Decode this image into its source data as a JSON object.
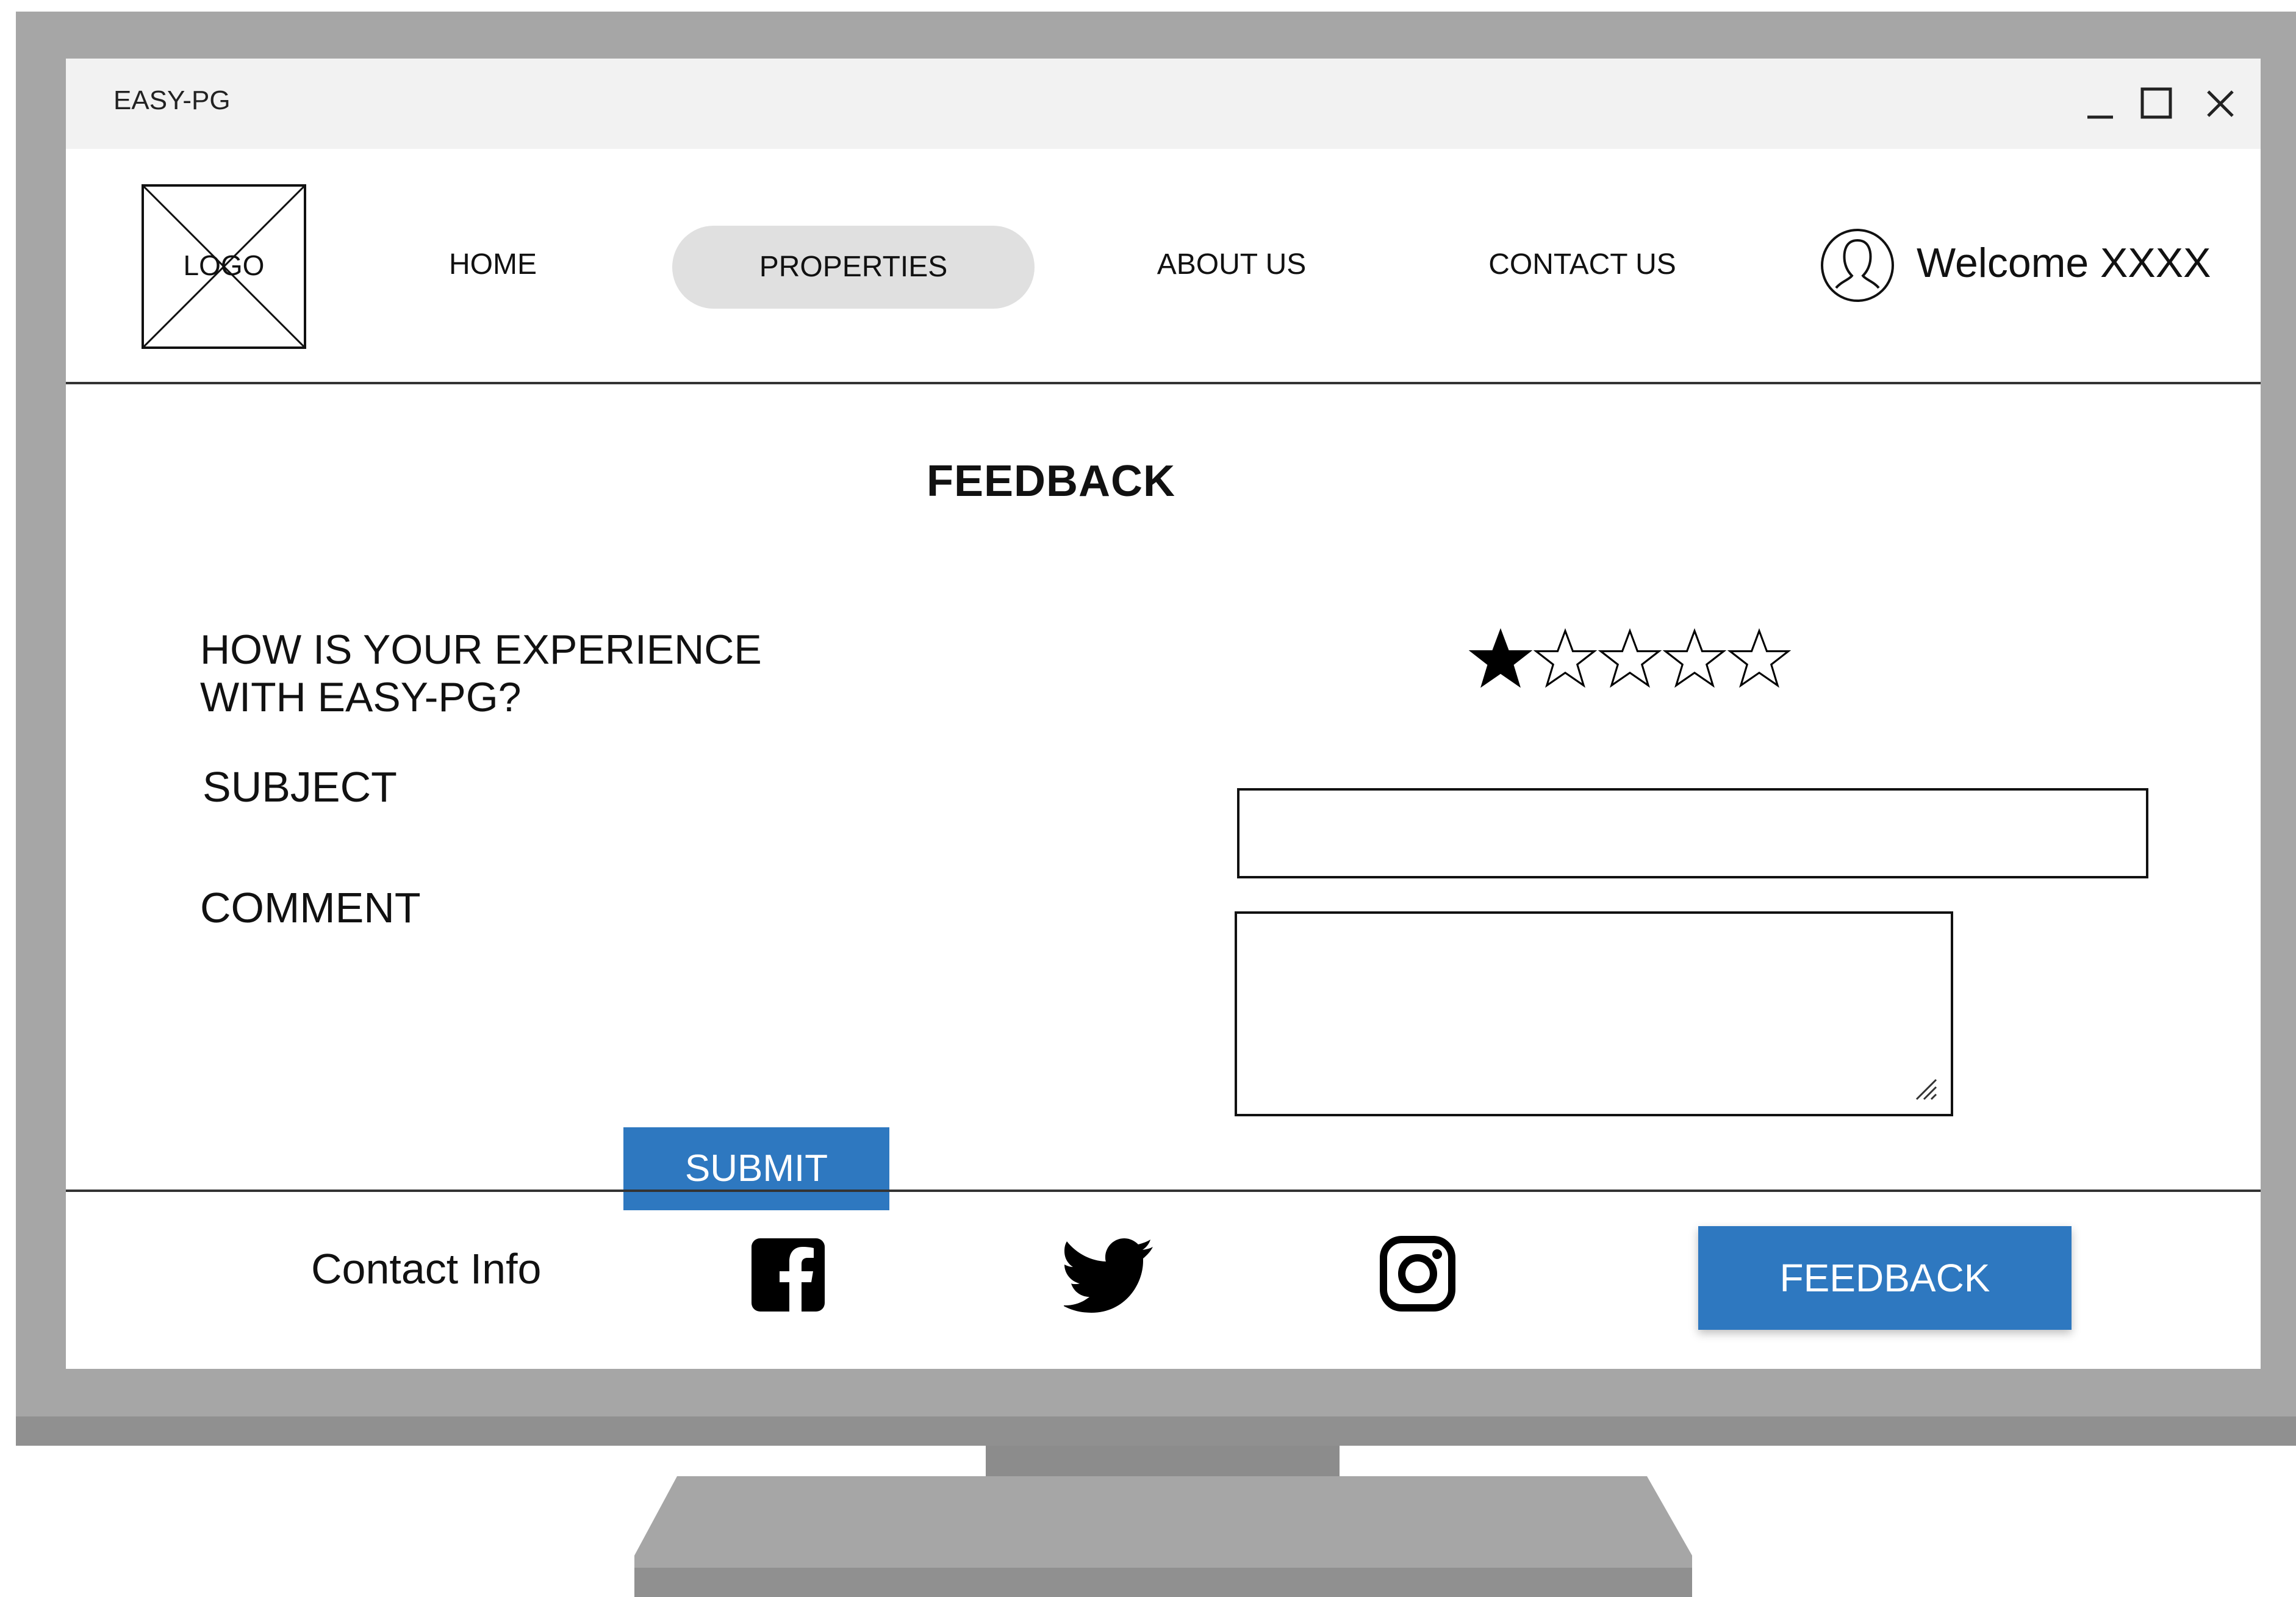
{
  "window": {
    "title": "EASY-PG"
  },
  "header": {
    "logo_text": "LOGO",
    "nav": [
      {
        "label": "HOME",
        "active": false
      },
      {
        "label": "PROPERTIES",
        "active": true
      },
      {
        "label": "ABOUT US",
        "active": false
      },
      {
        "label": "CONTACT US",
        "active": false
      }
    ],
    "welcome": "Welcome XXXX"
  },
  "main": {
    "title": "FEEDBACK",
    "question": "HOW IS YOUR EXPERIENCE WITH EASY-PG?",
    "rating": {
      "value": 1,
      "max": 5
    },
    "subject_label": "SUBJECT",
    "subject_value": "",
    "comment_label": "COMMENT",
    "comment_value": "",
    "submit_label": "SUBMIT"
  },
  "footer": {
    "contact_info": "Contact Info",
    "social_icons": [
      "facebook-icon",
      "twitter-icon",
      "instagram-icon"
    ],
    "feedback_label": "FEEDBACK"
  },
  "colors": {
    "accent": "#2e78c0",
    "active_nav_bg": "#e0e0e0",
    "bezel": "#a6a6a6"
  }
}
